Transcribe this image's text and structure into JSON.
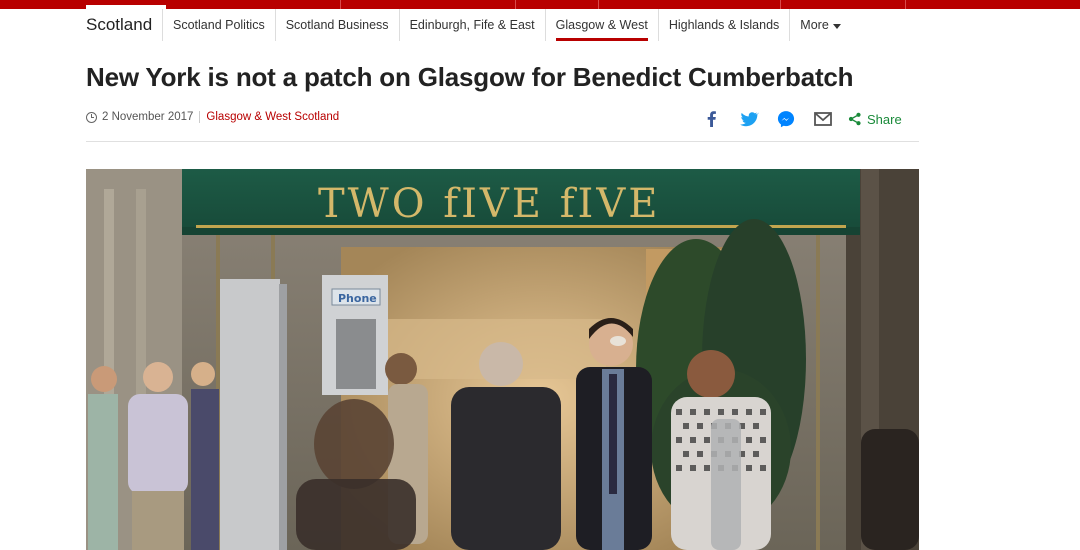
{
  "nav": {
    "brand": "Scotland",
    "links": [
      "Scotland Politics",
      "Scotland Business",
      "Edinburgh, Fife & East",
      "Glasgow & West",
      "Highlands & Islands"
    ],
    "active": "Glasgow & West",
    "more_label": "More"
  },
  "article": {
    "headline": "New York is not a patch on Glasgow for Benedict Cumberbatch",
    "date": "2 November 2017",
    "section": "Glasgow & West Scotland"
  },
  "share": {
    "icons": [
      "facebook-icon",
      "twitter-icon",
      "messenger-icon",
      "email-icon",
      "share-icon"
    ],
    "label": "Share"
  },
  "photo": {
    "awning_text": "TWO fIVE fIVE",
    "booth_label": "Phone"
  },
  "colors": {
    "brand_red": "#b80000",
    "share_green": "#1a8a3a",
    "facebook_blue": "#3b5998",
    "twitter_blue": "#1da1f2",
    "messenger_blue": "#0084ff",
    "awning_green": "#1f5a44"
  }
}
